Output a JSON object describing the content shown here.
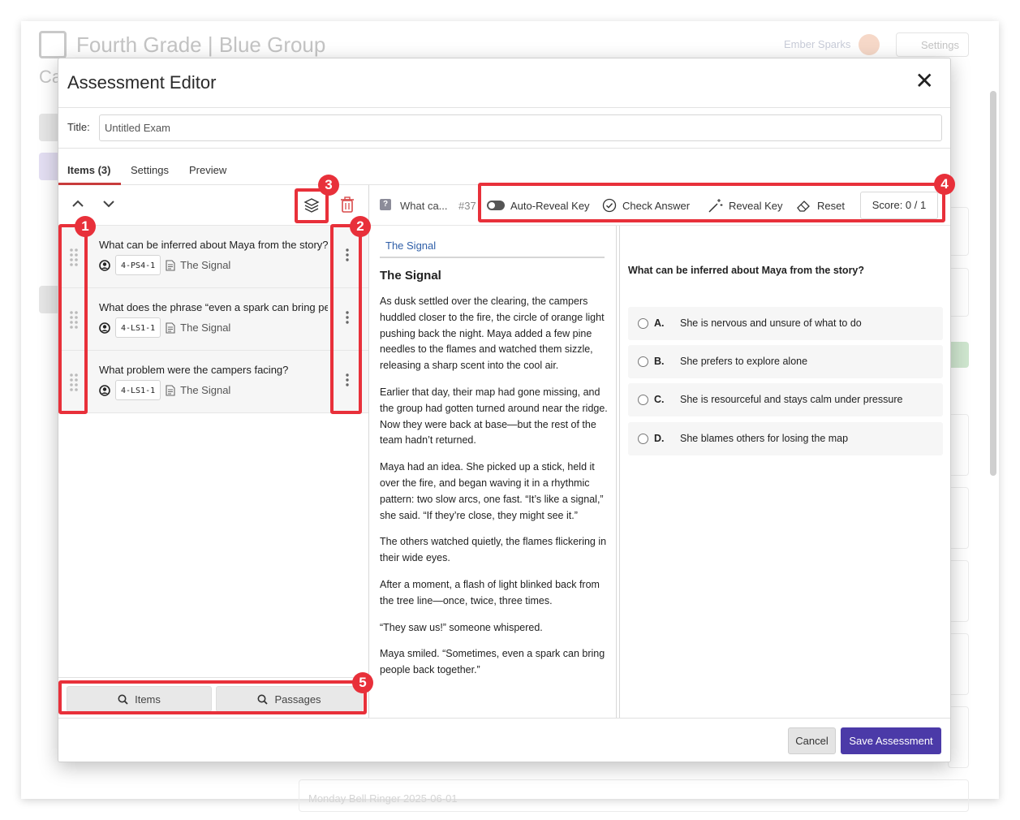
{
  "background": {
    "app_title": "Fourth Grade | Blue Group",
    "subtitle": "Ca",
    "user_name": "Ember Sparks",
    "settings_label": "Settings",
    "bottom_card_text": "Monday Bell Ringer 2025-06-01"
  },
  "modal": {
    "title": "Assessment Editor",
    "title_label": "Title:",
    "title_value": "Untitled Exam",
    "tabs": [
      {
        "label": "Items (3)",
        "active": true
      },
      {
        "label": "Settings",
        "active": false
      },
      {
        "label": "Preview",
        "active": false
      }
    ],
    "items": [
      {
        "question": "What can be inferred about Maya from the story?",
        "standard": "4-PS4-1",
        "passage": "The Signal"
      },
      {
        "question": "What does the phrase “even a spark can bring people back together”",
        "standard": "4-LS1-1",
        "passage": "The Signal"
      },
      {
        "question": "What problem were the campers facing?",
        "standard": "4-LS1-1",
        "passage": "The Signal"
      }
    ],
    "footer_search": {
      "items_label": "Items",
      "passages_label": "Passages"
    },
    "toolbar": {
      "question_short": "What ca...",
      "item_number": "#37",
      "auto_reveal_label": "Auto-Reveal Key",
      "check_answer_label": "Check Answer",
      "reveal_key_label": "Reveal Key",
      "reset_label": "Reset",
      "score": "Score: 0 / 1"
    },
    "passage": {
      "tab_label": "The Signal",
      "title": "The Signal",
      "paragraphs": [
        "As dusk settled over the clearing, the campers huddled closer to the fire, the circle of orange light pushing back the night. Maya added a few pine needles to the flames and watched them sizzle, releasing a sharp scent into the cool air.",
        "Earlier that day, their map had gone missing, and the group had gotten turned around near the ridge. Now they were back at base—but the rest of the team hadn’t returned.",
        "Maya had an idea. She picked up a stick, held it over the fire, and began waving it in a rhythmic pattern: two slow arcs, one fast. “It’s like a signal,” she said. “If they’re close, they might see it.”",
        "The others watched quietly, the flames flickering in their wide eyes.",
        "After a moment, a flash of light blinked back from the tree line—once, twice, three times.",
        "“They saw us!” someone whispered.",
        "Maya smiled. “Sometimes, even a spark can bring people back together.”"
      ]
    },
    "question": {
      "stem": "What can be inferred about Maya from the story?",
      "choices": [
        {
          "letter": "A.",
          "text": "She is nervous and unsure of what to do"
        },
        {
          "letter": "B.",
          "text": "She prefers to explore alone"
        },
        {
          "letter": "C.",
          "text": "She is resourceful and stays calm under pressure"
        },
        {
          "letter": "D.",
          "text": "She blames others for losing the map"
        }
      ]
    },
    "buttons": {
      "cancel": "Cancel",
      "save": "Save Assessment"
    }
  },
  "callouts": [
    "1",
    "2",
    "3",
    "4",
    "5"
  ],
  "colors": {
    "accent": "#4b3aa8",
    "callout": "#e8303a",
    "tab_underline": "#c83c3c",
    "delete": "#d94a4a",
    "link": "#2f5fa8"
  },
  "icons": [
    "close-icon",
    "chevron-up-icon",
    "chevron-down-icon",
    "layers-icon",
    "trash-icon",
    "drag-handle-icon",
    "user-circle-icon",
    "document-icon",
    "kebab-icon",
    "search-icon",
    "question-type-icon",
    "toggle-icon",
    "check-circle-icon",
    "magic-wand-icon",
    "eraser-icon"
  ]
}
